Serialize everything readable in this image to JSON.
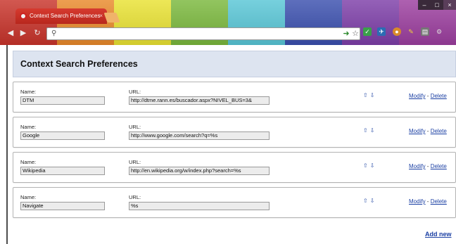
{
  "browser": {
    "tab_title": "Context Search Preferences",
    "tab_close": "×",
    "window_controls": [
      "–",
      "□",
      "×"
    ],
    "omnibox_value": "",
    "stripe_colors": [
      "#c8332a",
      "#e9892a",
      "#e9e232",
      "#7ab83c",
      "#58c6d6",
      "#3a4fae",
      "#7d3ea8",
      "#9c3e9f"
    ]
  },
  "header": {
    "title": "Context Search Preferences",
    "background": "#dde4f0"
  },
  "labels": {
    "name": "Name:",
    "url": "URL:",
    "modify": "Modify",
    "separator": "-",
    "delete": "Delete",
    "up_arrow": "⇧",
    "down_arrow": "⇩"
  },
  "entries": [
    {
      "name": "DTM",
      "url": "http://dtme.rann.es/buscador.aspx?NIVEL_BUS=3&"
    },
    {
      "name": "Google",
      "url": "http://www.google.com/search?q=%s"
    },
    {
      "name": "Wikipedia",
      "url": "http://en.wikipedia.org/w/index.php?search=%s"
    },
    {
      "name": "Navigate",
      "url": "%s"
    }
  ],
  "footer": {
    "add_new": "Add new"
  },
  "link_color": "#1a3fa3"
}
